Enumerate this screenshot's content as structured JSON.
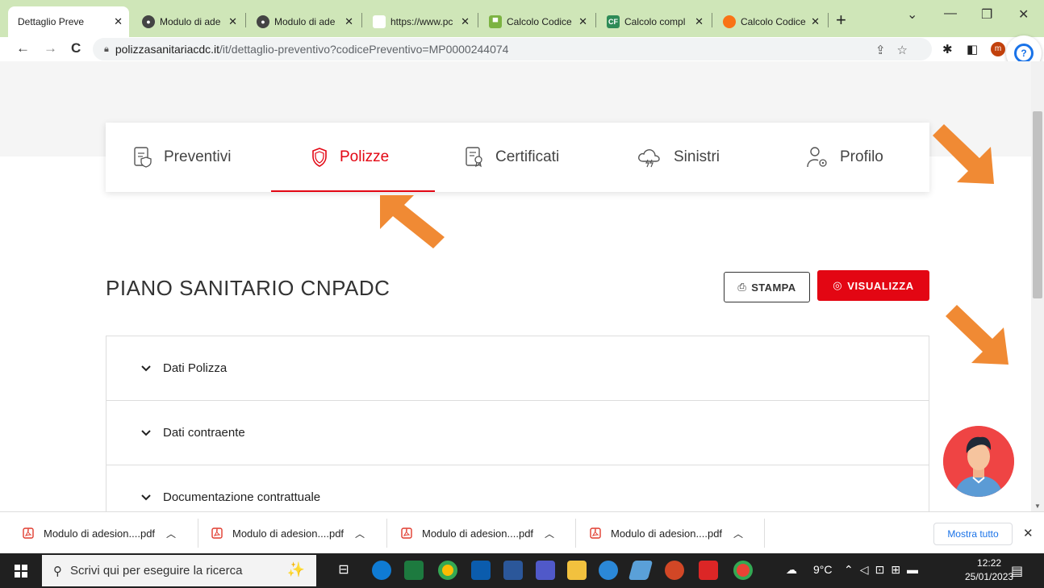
{
  "browser": {
    "tabs": [
      {
        "title": "Dettaglio Preve",
        "favicon": "blank",
        "color": "#ffffff"
      },
      {
        "title": "Modulo di ade",
        "favicon": "globe-icon",
        "color": "#444444"
      },
      {
        "title": "Modulo di ade",
        "favicon": "globe-icon",
        "color": "#444444"
      },
      {
        "title": "https://www.pc",
        "favicon": "blank",
        "color": "#ffffff"
      },
      {
        "title": "Calcolo Codice",
        "favicon": "hat-icon",
        "color": "#7cb342"
      },
      {
        "title": "Calcolo compl",
        "favicon": "cf-icon",
        "color": "#2e8b57"
      },
      {
        "title": "Calcolo Codice",
        "favicon": "circle-icon",
        "color": "#f97316"
      }
    ],
    "close_glyph": "✕",
    "new_tab": "+",
    "window_controls": [
      "⌄",
      "—",
      "❐",
      "✕"
    ],
    "nav": {
      "back": "←",
      "forward": "→",
      "reload": "C"
    },
    "url_host": "polizzasanitariacdc.it",
    "url_path": "/it/dettaglio-preventivo?codicePreventivo=MP0000244074",
    "profile_initial": "m"
  },
  "nav": {
    "items": [
      {
        "label": "Preventivi",
        "icon": "document-shield-icon"
      },
      {
        "label": "Polizze",
        "icon": "shield-icon",
        "active": true
      },
      {
        "label": "Certificati",
        "icon": "certificate-icon"
      },
      {
        "label": "Sinistri",
        "icon": "storm-cloud-icon"
      },
      {
        "label": "Profilo",
        "icon": "user-settings-icon"
      }
    ]
  },
  "main": {
    "title": "PIANO SANITARIO CNPADC",
    "stampa_label": "STAMPA",
    "visualizza_label": "VISUALIZZA",
    "accordion": [
      "Dati Polizza",
      "Dati contraente",
      "Documentazione contrattuale"
    ]
  },
  "downloads": {
    "items": [
      "Modulo di adesion....pdf",
      "Modulo di adesion....pdf",
      "Modulo di adesion....pdf",
      "Modulo di adesion....pdf"
    ],
    "show_all": "Mostra tutto",
    "close": "✕"
  },
  "taskbar": {
    "search_placeholder": "Scrivi qui per eseguire la ricerca",
    "weather": "9°C",
    "time": "12:22",
    "date": "25/01/2023"
  },
  "colors": {
    "accent": "#e30613",
    "arrow": "#f08a34",
    "tab_strip": "#cfe6b8"
  }
}
